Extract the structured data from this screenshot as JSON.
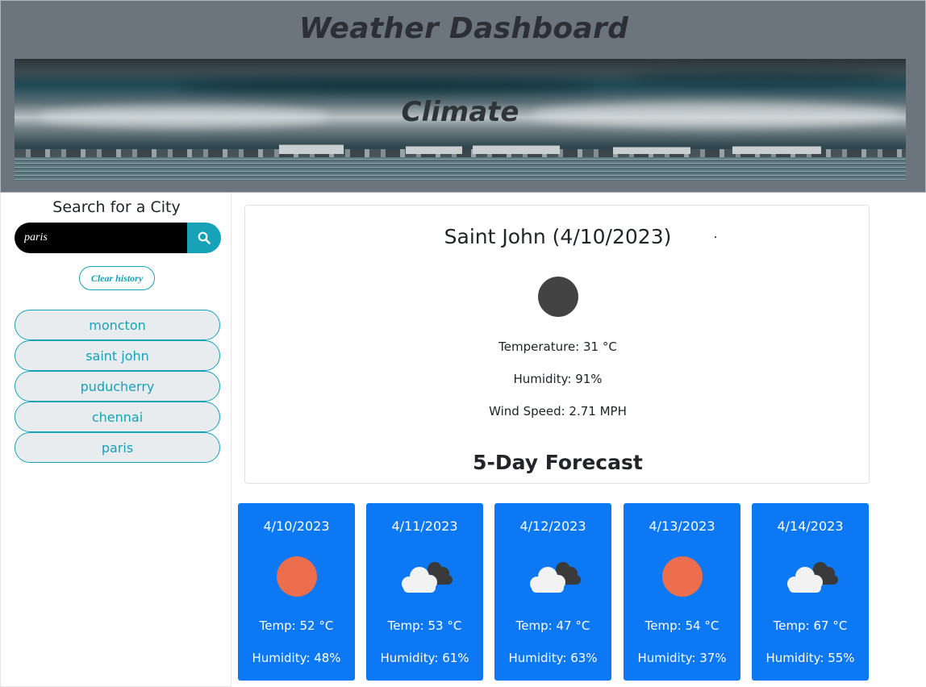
{
  "header": {
    "title": "Weather Dashboard",
    "banner_label": "Climate"
  },
  "sidebar": {
    "search_title": "Search for a City",
    "search_value": "paris",
    "search_icon": "search-icon",
    "clear_label": "Clear history",
    "history": [
      {
        "label": "moncton"
      },
      {
        "label": "saint john"
      },
      {
        "label": "puducherry"
      },
      {
        "label": "chennai"
      },
      {
        "label": "paris"
      }
    ]
  },
  "current": {
    "title": "Saint John (4/10/2023)",
    "icon": "dark-circle-icon",
    "temperature": "Temperature: 31 °C",
    "humidity": "Humidity: 91%",
    "wind": "Wind Speed: 2.71 MPH"
  },
  "forecast": {
    "title": "5-Day Forecast",
    "days": [
      {
        "date": "4/10/2023",
        "icon": "sun-icon",
        "temp": "Temp: 52 °C",
        "humidity": "Humidity: 48%"
      },
      {
        "date": "4/11/2023",
        "icon": "cloud-icon",
        "temp": "Temp: 53 °C",
        "humidity": "Humidity: 61%"
      },
      {
        "date": "4/12/2023",
        "icon": "cloud-icon",
        "temp": "Temp: 47 °C",
        "humidity": "Humidity: 63%"
      },
      {
        "date": "4/13/2023",
        "icon": "sun-icon",
        "temp": "Temp: 54 °C",
        "humidity": "Humidity: 37%"
      },
      {
        "date": "4/14/2023",
        "icon": "cloud-icon",
        "temp": "Temp: 67 °C",
        "humidity": "Humidity: 55%"
      }
    ]
  },
  "colors": {
    "header_bg": "#6c757d",
    "accent": "#17a2b8",
    "forecast_card": "#0d78f3",
    "sun": "#ec6e4c"
  }
}
